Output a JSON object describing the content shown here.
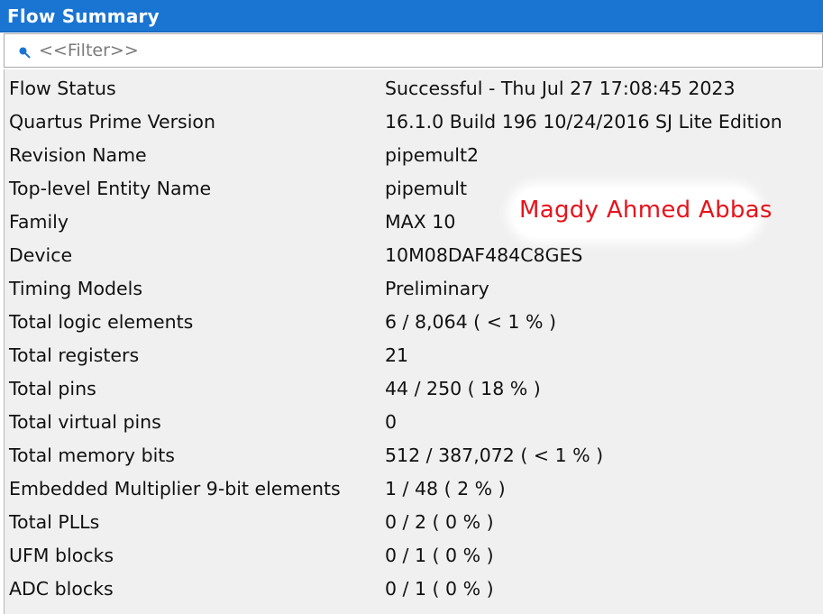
{
  "window": {
    "title": "Flow Summary"
  },
  "filter": {
    "placeholder": "<<Filter>>",
    "icon": "search-icon"
  },
  "rows": [
    {
      "label": "Flow Status",
      "value": "Successful - Thu Jul 27 17:08:45 2023"
    },
    {
      "label": "Quartus Prime Version",
      "value": "16.1.0 Build 196 10/24/2016 SJ Lite Edition"
    },
    {
      "label": "Revision Name",
      "value": "pipemult2"
    },
    {
      "label": "Top-level Entity Name",
      "value": "pipemult"
    },
    {
      "label": "Family",
      "value": "MAX 10"
    },
    {
      "label": "Device",
      "value": "10M08DAF484C8GES"
    },
    {
      "label": "Timing Models",
      "value": "Preliminary"
    },
    {
      "label": "Total logic elements",
      "value": "6 / 8,064 ( < 1 % )"
    },
    {
      "label": "Total registers",
      "value": "21"
    },
    {
      "label": "Total pins",
      "value": "44 / 250 ( 18 % )"
    },
    {
      "label": "Total virtual pins",
      "value": "0"
    },
    {
      "label": "Total memory bits",
      "value": "512 / 387,072 ( < 1 % )"
    },
    {
      "label": "Embedded Multiplier 9-bit elements",
      "value": "1 / 48 ( 2 % )"
    },
    {
      "label": "Total PLLs",
      "value": "0 / 2 ( 0 % )"
    },
    {
      "label": "UFM blocks",
      "value": "0 / 1 ( 0 % )"
    },
    {
      "label": "ADC blocks",
      "value": "0 / 1 ( 0 % )"
    }
  ],
  "watermark": {
    "text": "Magdy Ahmed Abbas"
  },
  "colors": {
    "title_bar": "#1a74d1",
    "table_background": "#f0f0f0",
    "watermark_text": "#e5141c",
    "search_icon": "#1a74d1"
  }
}
